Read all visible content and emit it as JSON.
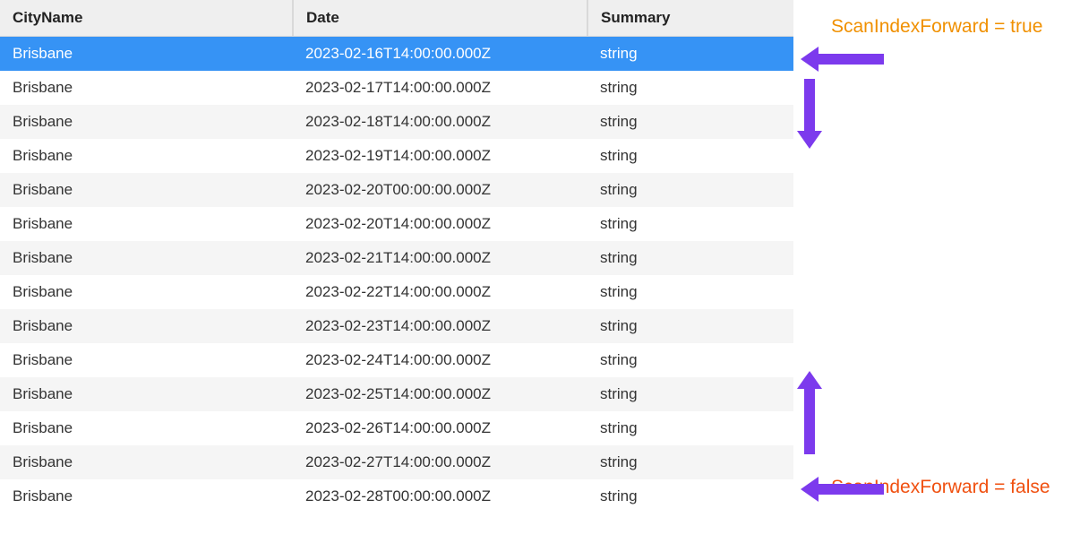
{
  "table": {
    "columns": [
      "CityName",
      "Date",
      "Summary"
    ]
  },
  "rows": [
    {
      "city": "Brisbane",
      "date": "2023-02-16T14:00:00.000Z",
      "summary": "string",
      "selected": true
    },
    {
      "city": "Brisbane",
      "date": "2023-02-17T14:00:00.000Z",
      "summary": "string",
      "selected": false
    },
    {
      "city": "Brisbane",
      "date": "2023-02-18T14:00:00.000Z",
      "summary": "string",
      "selected": false
    },
    {
      "city": "Brisbane",
      "date": "2023-02-19T14:00:00.000Z",
      "summary": "string",
      "selected": false
    },
    {
      "city": "Brisbane",
      "date": "2023-02-20T00:00:00.000Z",
      "summary": "string",
      "selected": false
    },
    {
      "city": "Brisbane",
      "date": "2023-02-20T14:00:00.000Z",
      "summary": "string",
      "selected": false
    },
    {
      "city": "Brisbane",
      "date": "2023-02-21T14:00:00.000Z",
      "summary": "string",
      "selected": false
    },
    {
      "city": "Brisbane",
      "date": "2023-02-22T14:00:00.000Z",
      "summary": "string",
      "selected": false
    },
    {
      "city": "Brisbane",
      "date": "2023-02-23T14:00:00.000Z",
      "summary": "string",
      "selected": false
    },
    {
      "city": "Brisbane",
      "date": "2023-02-24T14:00:00.000Z",
      "summary": "string",
      "selected": false
    },
    {
      "city": "Brisbane",
      "date": "2023-02-25T14:00:00.000Z",
      "summary": "string",
      "selected": false
    },
    {
      "city": "Brisbane",
      "date": "2023-02-26T14:00:00.000Z",
      "summary": "string",
      "selected": false
    },
    {
      "city": "Brisbane",
      "date": "2023-02-27T14:00:00.000Z",
      "summary": "string",
      "selected": false
    },
    {
      "city": "Brisbane",
      "date": "2023-02-28T00:00:00.000Z",
      "summary": "string",
      "selected": false
    }
  ],
  "annotations": {
    "forward_true": "ScanIndexForward = true",
    "forward_false": "ScanIndexForward = false"
  }
}
